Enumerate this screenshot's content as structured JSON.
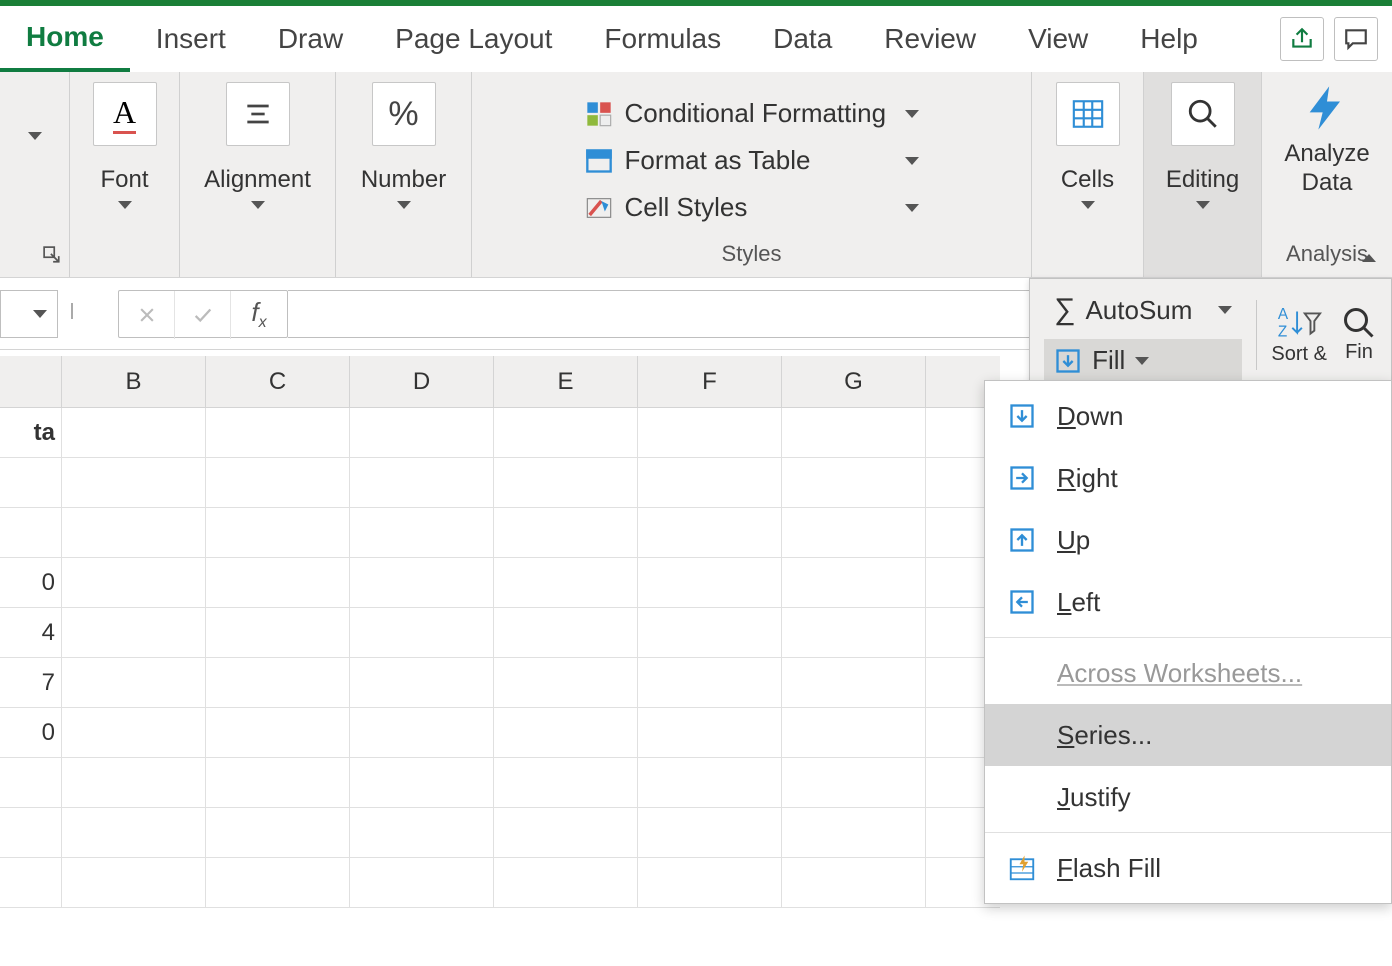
{
  "tabs": {
    "home": "Home",
    "insert": "Insert",
    "draw": "Draw",
    "page_layout": "Page Layout",
    "formulas": "Formulas",
    "data": "Data",
    "review": "Review",
    "view": "View",
    "help": "Help"
  },
  "ribbon": {
    "font": "Font",
    "alignment": "Alignment",
    "number": "Number",
    "styles": {
      "label": "Styles",
      "conditional_formatting": "Conditional Formatting",
      "format_as_table": "Format as Table",
      "cell_styles": "Cell Styles"
    },
    "cells": "Cells",
    "editing": "Editing",
    "analyze_data": "Analyze Data",
    "analysis": "Analysis"
  },
  "editing_popout": {
    "autosum": "AutoSum",
    "fill": "Fill",
    "sort": "Sort &",
    "find": "Fin"
  },
  "fill_menu": {
    "down": "Down",
    "right": "Right",
    "up": "Up",
    "left": "Left",
    "across": "Across Worksheets...",
    "series": "Series...",
    "justify": "Justify",
    "flash_fill": "Flash Fill"
  },
  "grid": {
    "columns": [
      "B",
      "C",
      "D",
      "E",
      "F",
      "G"
    ],
    "partial_header_cell": "ta",
    "row_values": [
      "",
      "",
      "",
      "0",
      "4",
      "7",
      "0",
      "",
      "",
      ""
    ]
  }
}
